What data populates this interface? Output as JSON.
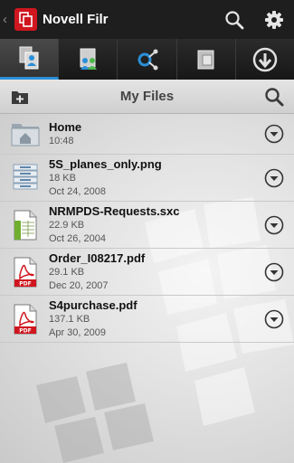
{
  "app": {
    "title": "Novell Filr",
    "back_glyph": "‹"
  },
  "toolbar": {
    "items": [
      "my-files-icon",
      "shared-with-me-icon",
      "shared-by-me-icon",
      "net-folders-icon",
      "download-icon"
    ],
    "active_index": 0
  },
  "header": {
    "title": "My Files"
  },
  "files": [
    {
      "name": "Home",
      "size": "",
      "date": "10:48",
      "icon": "folder-home-icon"
    },
    {
      "name": "5S_planes_only.png",
      "size": "18 KB",
      "date": "Oct 24, 2008",
      "icon": "image-file-icon"
    },
    {
      "name": "NRMPDS-Requests.sxc",
      "size": "22.9 KB",
      "date": "Oct 26, 2004",
      "icon": "spreadsheet-file-icon"
    },
    {
      "name": "Order_I08217.pdf",
      "size": "29.1 KB",
      "date": "Dec 20, 2007",
      "icon": "pdf-file-icon"
    },
    {
      "name": "S4purchase.pdf",
      "size": "137.1 KB",
      "date": "Apr 30, 2009",
      "icon": "pdf-file-icon"
    }
  ],
  "colors": {
    "brand": "#d0161e",
    "accent": "#2a8fd8"
  }
}
